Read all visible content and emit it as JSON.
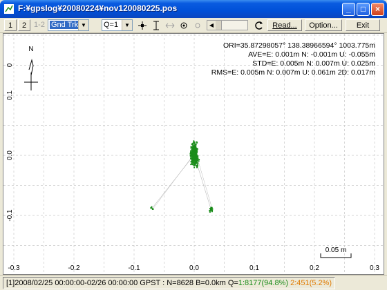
{
  "window": {
    "title": "F:¥gpslog¥20080224¥nov120080225.pos"
  },
  "toolbar": {
    "btn1": "1",
    "btn2": "2",
    "btn12": "1-2",
    "plot_type": "Gnd Trk",
    "quality": "Q=1",
    "read_label": "Read...",
    "option_label": "Option...",
    "exit_label": "Exit"
  },
  "stats": {
    "ori": "ORI=35.87298057° 138.38966594° 1003.775m",
    "ave": "AVE=E: 0.001m N: -0.001m U: -0.055m",
    "std": "STD=E: 0.005m N: 0.007m U: 0.025m",
    "rms": "RMS=E: 0.005m N: 0.007m U: 0.061m 2D: 0.017m"
  },
  "compass": {
    "north": "N"
  },
  "scale_label": "0.05 m",
  "axes": {
    "x_ticks": [
      "-0.3",
      "-0.2",
      "-0.1",
      "0.0",
      "0.1",
      "0.2",
      "0.3"
    ],
    "y_ticks": [
      "0",
      "0.1",
      "0.0",
      "-0.1"
    ]
  },
  "status": {
    "prefix": "[1]2008/02/25 00:00:00-02/26 00:00:00 GPST : N=8628 B=0.0km Q=",
    "q1": "1:8177(94.8%)",
    "q2": "2:451(5.2%)"
  },
  "colors": {
    "fix": "#1a8c1a",
    "float": "#e07a00",
    "track_line": "#bbbbbb",
    "grid": "#c8c8c8"
  },
  "chart_data": {
    "type": "scatter",
    "x_range": [
      -0.3,
      0.3
    ],
    "y_range": [
      -0.14,
      0.15
    ],
    "grid": true,
    "clusters": [
      {
        "q": 1,
        "center_e": 0.0,
        "center_n": 0.001,
        "spread_e": 0.005,
        "spread_n": 0.007
      },
      {
        "q": 1,
        "center_e": -0.07,
        "center_n": -0.088,
        "spread_e": 0.002,
        "spread_n": 0.002
      },
      {
        "q": 1,
        "center_e": 0.028,
        "center_n": -0.09,
        "spread_e": 0.004,
        "spread_n": 0.003
      }
    ]
  }
}
